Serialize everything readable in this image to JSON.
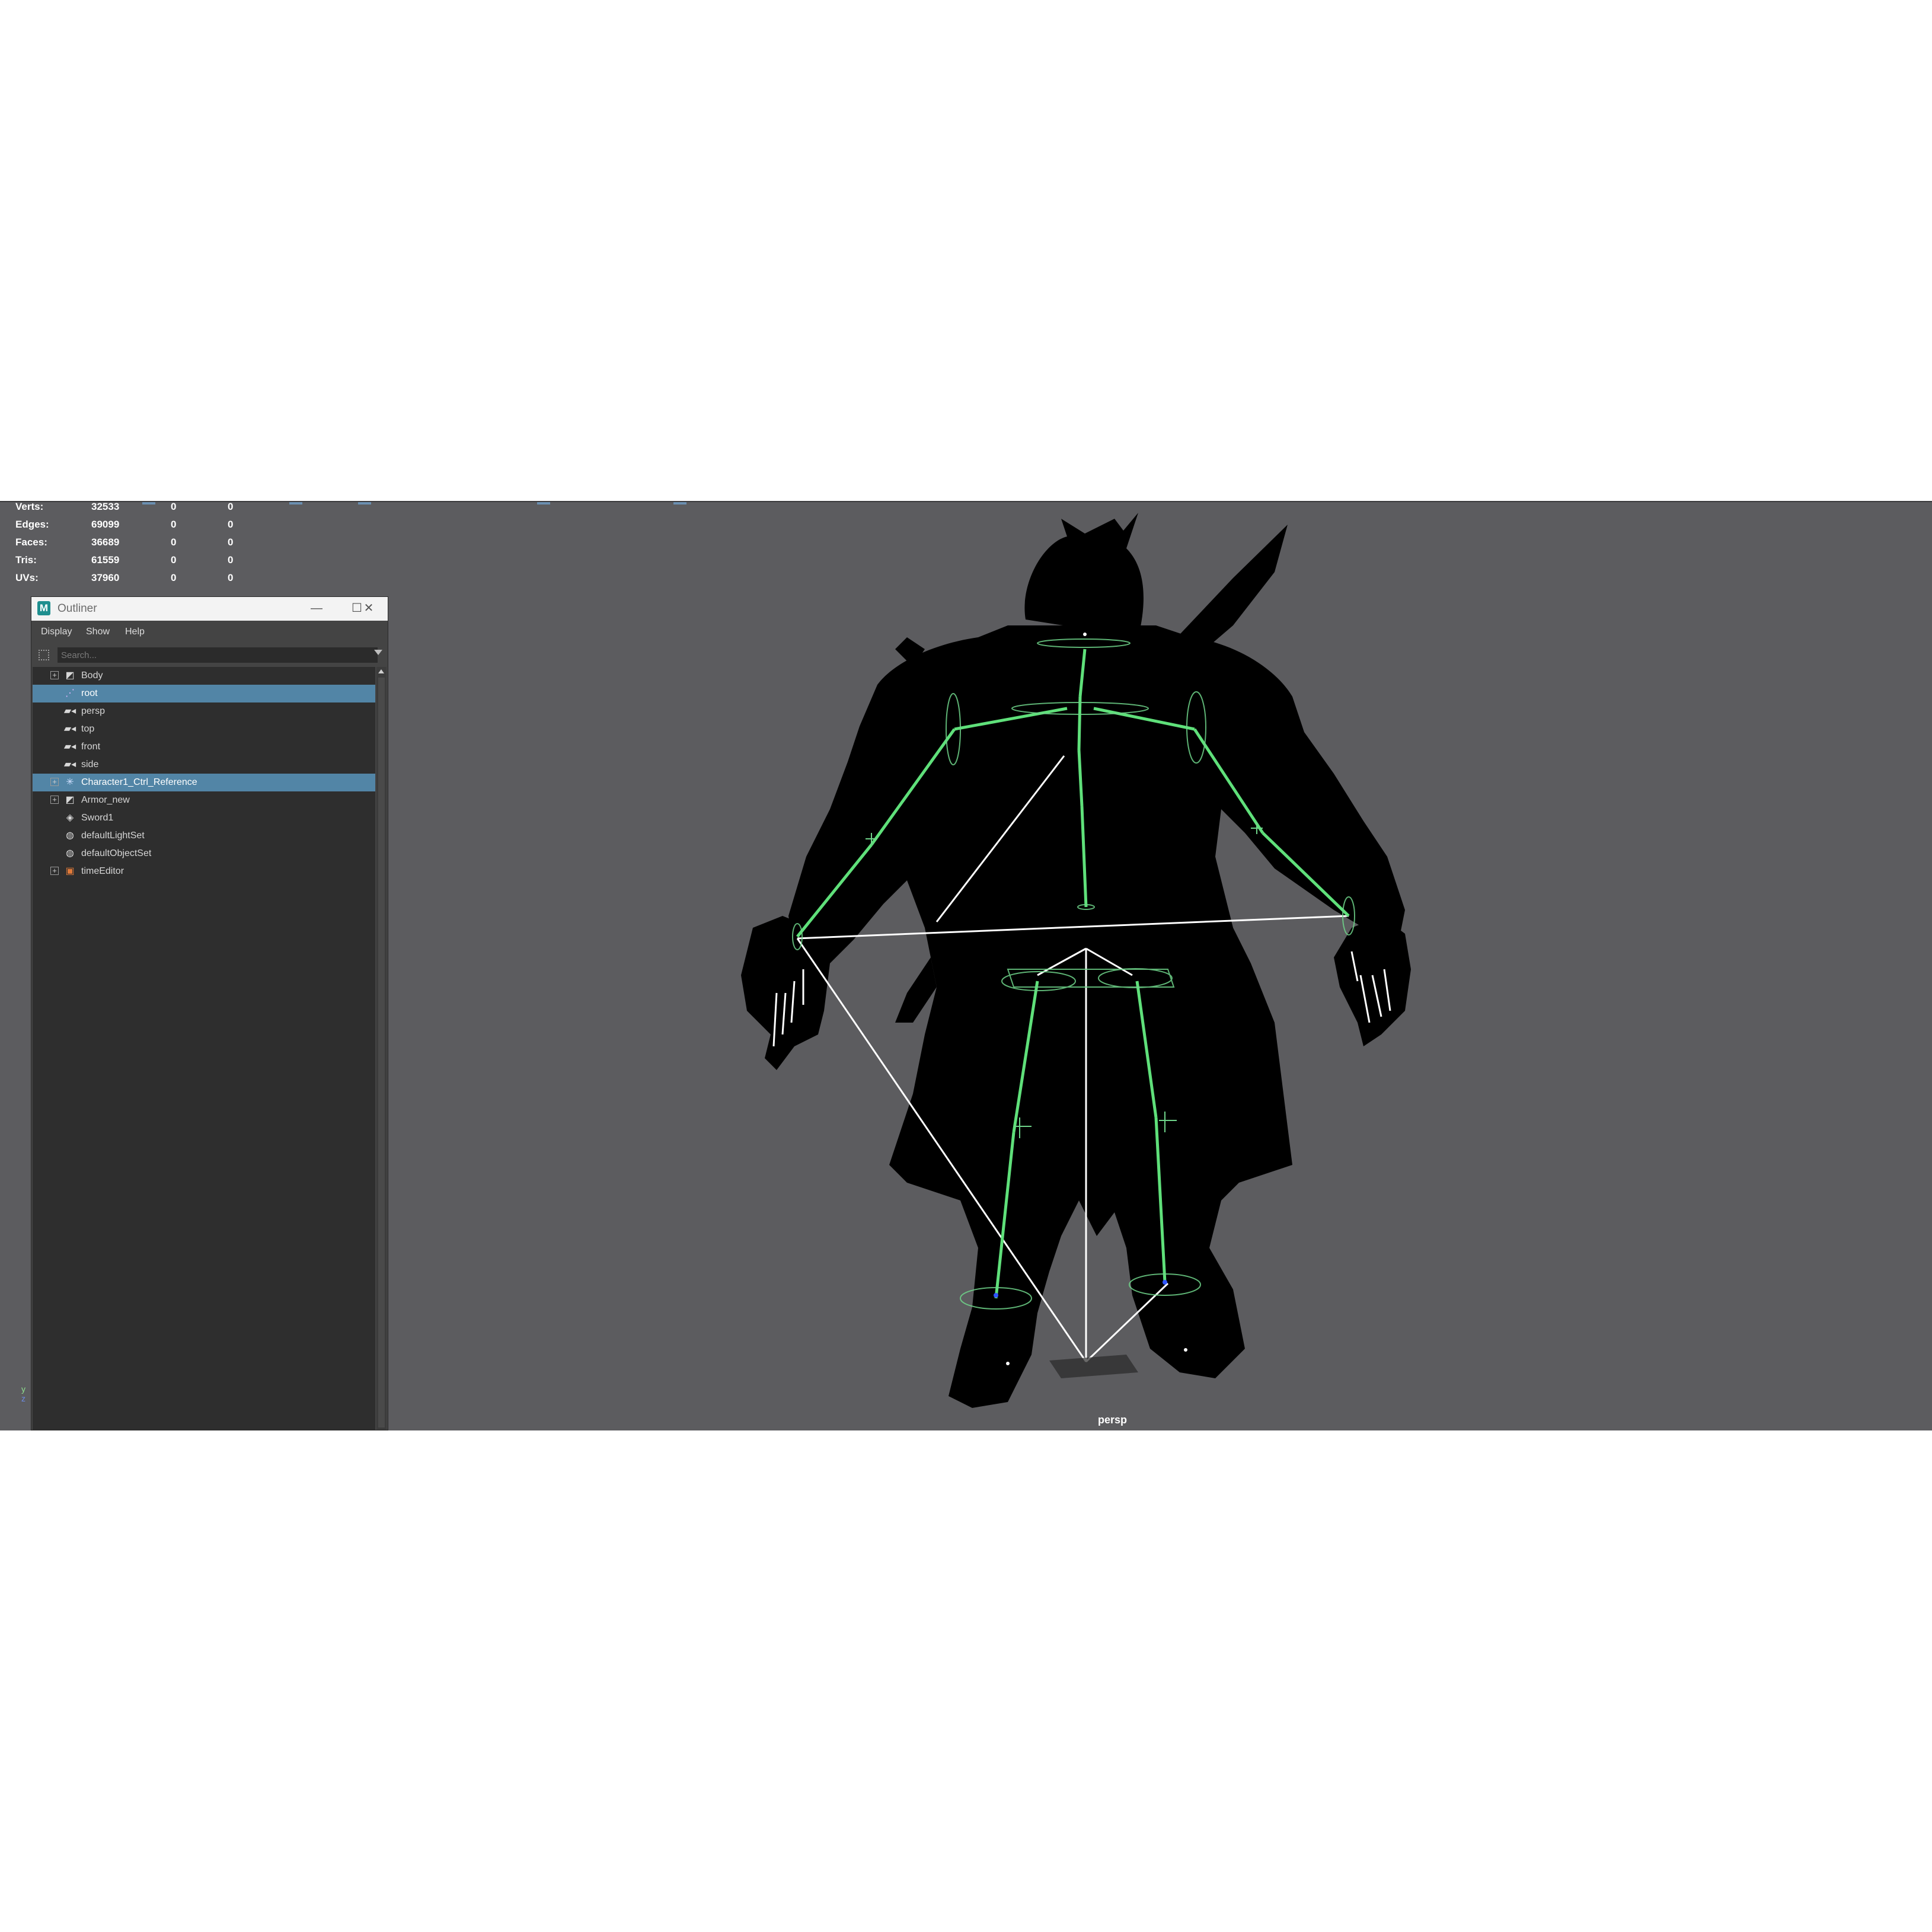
{
  "hud": {
    "rows": [
      {
        "label": "Verts:",
        "a": "32533",
        "b": "0",
        "c": "0"
      },
      {
        "label": "Edges:",
        "a": "69099",
        "b": "0",
        "c": "0"
      },
      {
        "label": "Faces:",
        "a": "36689",
        "b": "0",
        "c": "0"
      },
      {
        "label": "Tris:",
        "a": "61559",
        "b": "0",
        "c": "0"
      },
      {
        "label": "UVs:",
        "a": "37960",
        "b": "0",
        "c": "0"
      }
    ]
  },
  "viewport": {
    "camera_label": "persp",
    "axis": {
      "y": "y",
      "z": "z"
    },
    "background_color": "#5c5c5f",
    "joint_color": "#5fe07a"
  },
  "outliner": {
    "title": "Outliner",
    "logo": "M",
    "window_buttons": {
      "minimize": "—",
      "maximize": "☐",
      "close": "✕"
    },
    "menu": [
      "Display",
      "Show",
      "Help"
    ],
    "search_placeholder": "Search...",
    "items": [
      {
        "label": "Body",
        "icon": "mesh-icon",
        "expandable": true,
        "selected": false
      },
      {
        "label": "root",
        "icon": "joint-icon",
        "expandable": false,
        "selected": true
      },
      {
        "label": "persp",
        "icon": "camera-icon",
        "expandable": false,
        "selected": false
      },
      {
        "label": "top",
        "icon": "camera-icon",
        "expandable": false,
        "selected": false
      },
      {
        "label": "front",
        "icon": "camera-icon",
        "expandable": false,
        "selected": false
      },
      {
        "label": "side",
        "icon": "camera-icon",
        "expandable": false,
        "selected": false
      },
      {
        "label": "Character1_Ctrl_Reference",
        "icon": "hik-reference-icon",
        "expandable": true,
        "selected": true
      },
      {
        "label": "Armor_new",
        "icon": "mesh-icon",
        "expandable": true,
        "selected": false
      },
      {
        "label": "Sword1",
        "icon": "nurbs-icon",
        "expandable": false,
        "selected": false
      },
      {
        "label": "defaultLightSet",
        "icon": "set-icon",
        "expandable": false,
        "selected": false
      },
      {
        "label": "defaultObjectSet",
        "icon": "set-icon",
        "expandable": false,
        "selected": false
      },
      {
        "label": "timeEditor",
        "icon": "time-editor-icon",
        "expandable": true,
        "selected": false
      }
    ],
    "selection_color": "#5285a6"
  }
}
